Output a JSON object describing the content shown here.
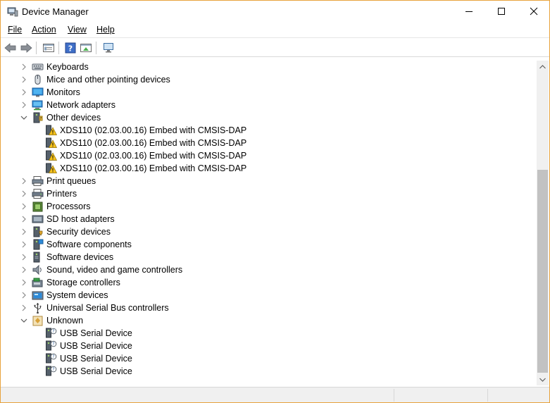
{
  "window": {
    "title": "Device Manager",
    "accent_border": "#e8a33d"
  },
  "menu": {
    "file": "File",
    "action": "Action",
    "view": "View",
    "help": "Help"
  },
  "toolbar": {
    "buttons": [
      "back-icon",
      "forward-icon",
      "properties-icon",
      "help-icon",
      "update-driver-icon",
      "scan-hardware-icon"
    ]
  },
  "tree": {
    "categories_top": [
      {
        "label": "Keyboards",
        "icon": "keyboard-icon"
      },
      {
        "label": "Mice and other pointing devices",
        "icon": "mouse-icon"
      },
      {
        "label": "Monitors",
        "icon": "monitor-icon"
      },
      {
        "label": "Network adapters",
        "icon": "network-adapter-icon"
      }
    ],
    "other_devices": {
      "label": "Other devices",
      "icon": "other-devices-icon",
      "expanded": true,
      "children": [
        "XDS110 (02.03.00.16) Embed with CMSIS-DAP",
        "XDS110 (02.03.00.16) Embed with CMSIS-DAP",
        "XDS110 (02.03.00.16) Embed with CMSIS-DAP",
        "XDS110 (02.03.00.16) Embed with CMSIS-DAP"
      ],
      "child_icon": "warning-device-icon"
    },
    "categories_middle": [
      {
        "label": "Print queues",
        "icon": "print-queue-icon"
      },
      {
        "label": "Printers",
        "icon": "printer-icon"
      },
      {
        "label": "Processors",
        "icon": "processor-icon"
      },
      {
        "label": "SD host adapters",
        "icon": "sd-host-icon"
      },
      {
        "label": "Security devices",
        "icon": "security-device-icon"
      },
      {
        "label": "Software components",
        "icon": "software-component-icon"
      },
      {
        "label": "Software devices",
        "icon": "software-device-icon"
      },
      {
        "label": "Sound, video and game controllers",
        "icon": "speaker-icon"
      },
      {
        "label": "Storage controllers",
        "icon": "storage-controller-icon"
      },
      {
        "label": "System devices",
        "icon": "system-devices-icon"
      },
      {
        "label": "Universal Serial Bus controllers",
        "icon": "usb-icon"
      }
    ],
    "unknown": {
      "label": "Unknown",
      "icon": "unknown-icon",
      "expanded": true,
      "children": [
        "USB Serial Device",
        "USB Serial Device",
        "USB Serial Device",
        "USB Serial Device"
      ],
      "child_icon": "unknown-device-icon"
    }
  }
}
